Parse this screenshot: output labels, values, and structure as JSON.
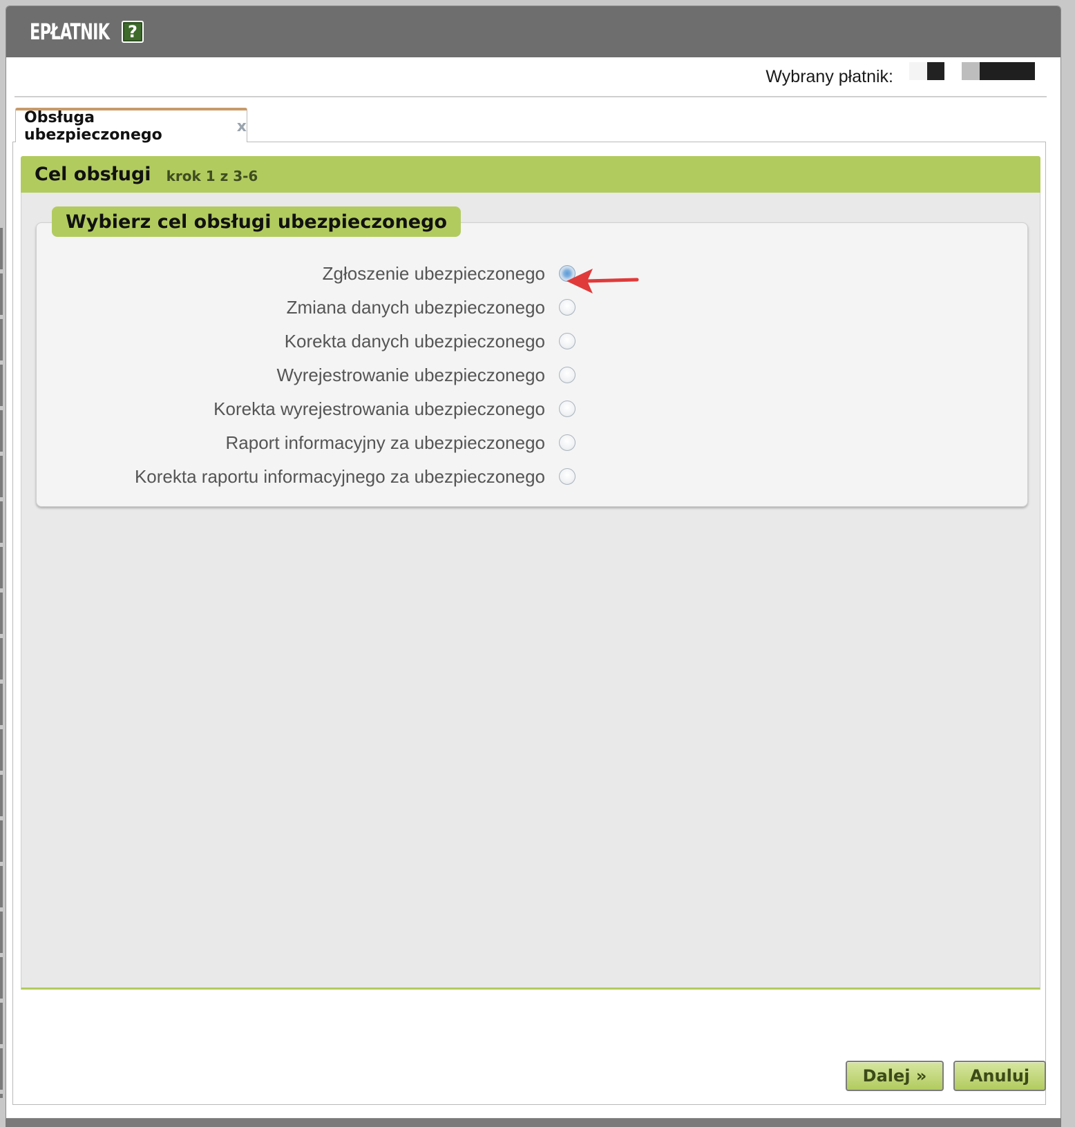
{
  "app": {
    "title": "EPŁATNIK",
    "help_glyph": "?"
  },
  "payer": {
    "label": "Wybrany płatnik:"
  },
  "tab": {
    "label": "Obsługa ubezpieczonego",
    "close_glyph": "x"
  },
  "step": {
    "title": "Cel obsługi",
    "info": "krok 1 z 3-6"
  },
  "fieldset": {
    "legend": "Wybierz cel obsługi ubezpieczonego",
    "options": [
      {
        "label": "Zgłoszenie ubezpieczonego",
        "checked": true
      },
      {
        "label": "Zmiana danych ubezpieczonego",
        "checked": false
      },
      {
        "label": "Korekta danych ubezpieczonego",
        "checked": false
      },
      {
        "label": "Wyrejestrowanie ubezpieczonego",
        "checked": false
      },
      {
        "label": "Korekta wyrejestrowania ubezpieczonego",
        "checked": false
      },
      {
        "label": "Raport informacyjny za ubezpieczonego",
        "checked": false
      },
      {
        "label": "Korekta raportu informacyjnego za ubezpieczonego",
        "checked": false
      }
    ]
  },
  "buttons": {
    "next": "Dalej »",
    "cancel": "Anuluj"
  },
  "colors": {
    "titlebar": "#6d6e6d",
    "accent_green": "#b2cb5f",
    "tab_top": "#c79a6a",
    "annotation_arrow": "#e03a3a"
  },
  "icons": {
    "help": "help-icon",
    "close": "close-icon",
    "arrow": "annotation-arrow-icon"
  }
}
